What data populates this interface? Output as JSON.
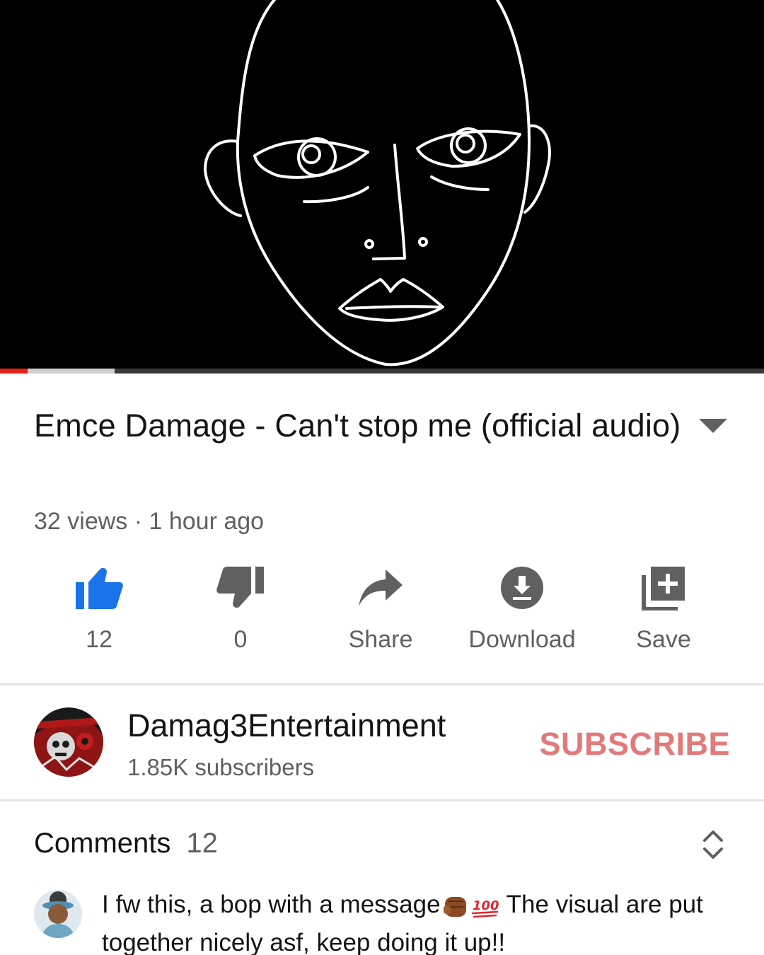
{
  "video": {
    "progress_played_fraction": 0.036,
    "progress_buffered_fraction": 0.15
  },
  "title": "Emce Damage - Can't stop me (official audio)",
  "meta": "32 views · 1 hour ago",
  "actions": {
    "like": {
      "label": "12",
      "icon": "thumbs-up-icon",
      "color": "#1a73e8"
    },
    "dislike": {
      "label": "0",
      "icon": "thumbs-down-icon"
    },
    "share": {
      "label": "Share",
      "icon": "share-arrow-icon"
    },
    "download": {
      "label": "Download",
      "icon": "download-icon"
    },
    "save": {
      "label": "Save",
      "icon": "add-to-playlist-icon"
    }
  },
  "channel": {
    "name": "Damag3Entertainment",
    "subscribers": "1.85K subscribers",
    "subscribe_label": "SUBSCRIBE",
    "subscribe_color": "#e2797a"
  },
  "comments": {
    "label": "Comments",
    "count": "12",
    "items": [
      {
        "text_before": "I fw this, a bop with a message",
        "emojis": [
          "raised-fist-icon",
          "hundred-points-icon"
        ],
        "text_after": " The visual are put together nicely asf, keep doing it up!!"
      }
    ]
  }
}
